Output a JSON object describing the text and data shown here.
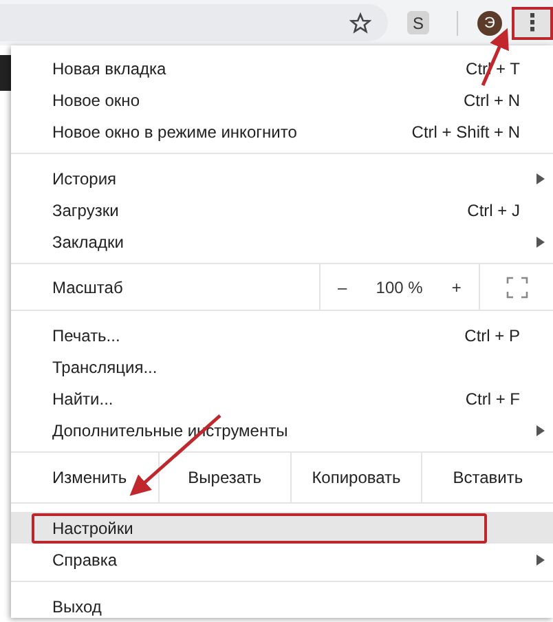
{
  "toolbar": {
    "extension_letter": "S",
    "profile_letter": "Э",
    "menu_button": {
      "glyph": "⋮",
      "highlighted": true
    }
  },
  "menu": [
    {
      "kind": "item",
      "label": "Новая вкладка",
      "shortcut": "Ctrl + T",
      "submenu": false,
      "highlighted": false
    },
    {
      "kind": "item",
      "label": "Новое окно",
      "shortcut": "Ctrl + N",
      "submenu": false,
      "highlighted": false
    },
    {
      "kind": "item",
      "label": "Новое окно в режиме инкогнито",
      "shortcut": "Ctrl + Shift + N",
      "submenu": false,
      "highlighted": false
    },
    {
      "kind": "divider"
    },
    {
      "kind": "item",
      "label": "История",
      "submenu": true,
      "highlighted": false
    },
    {
      "kind": "item",
      "label": "Загрузки",
      "shortcut": "Ctrl + J",
      "submenu": false,
      "highlighted": false
    },
    {
      "kind": "item",
      "label": "Закладки",
      "submenu": true,
      "highlighted": false
    },
    {
      "kind": "divider"
    },
    {
      "kind": "zoom",
      "label": "Масштаб",
      "minus": "–",
      "value": "100 %",
      "plus": "+"
    },
    {
      "kind": "divider"
    },
    {
      "kind": "item",
      "label": "Печать...",
      "shortcut": "Ctrl + P",
      "submenu": false,
      "highlighted": false
    },
    {
      "kind": "item",
      "label": "Трансляция...",
      "submenu": false,
      "highlighted": false
    },
    {
      "kind": "item",
      "label": "Найти...",
      "shortcut": "Ctrl + F",
      "submenu": false,
      "highlighted": false
    },
    {
      "kind": "item",
      "label": "Дополнительные инструменты",
      "submenu": true,
      "highlighted": false
    },
    {
      "kind": "divider"
    },
    {
      "kind": "edit",
      "label": "Изменить",
      "buttons": [
        "Вырезать",
        "Копировать",
        "Вставить"
      ]
    },
    {
      "kind": "divider"
    },
    {
      "kind": "item",
      "label": "Настройки",
      "submenu": false,
      "highlighted": true
    },
    {
      "kind": "item",
      "label": "Справка",
      "submenu": true,
      "highlighted": false
    },
    {
      "kind": "divider"
    },
    {
      "kind": "item",
      "label": "Выход",
      "submenu": false,
      "highlighted": false
    }
  ]
}
